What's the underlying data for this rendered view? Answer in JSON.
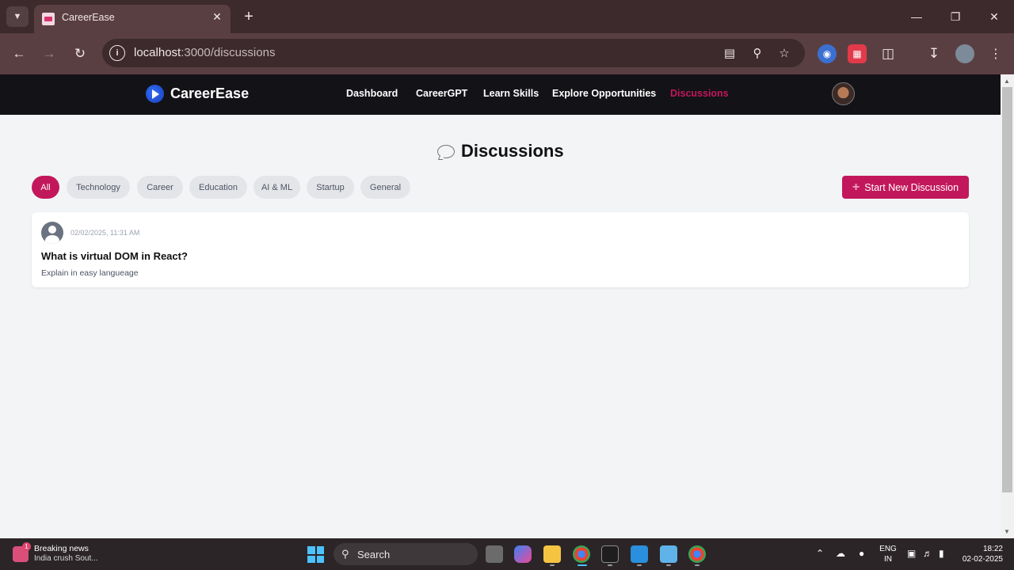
{
  "browser": {
    "tab_title": "CareerEase",
    "url_host": "localhost",
    "url_path": ":3000/discussions",
    "icons": {
      "tab_list": "chevron-down-icon",
      "close_tab": "close-icon",
      "new_tab": "plus-icon",
      "back": "arrow-left-icon",
      "forward": "arrow-right-icon",
      "reload": "reload-icon",
      "site_info": "info-icon",
      "install": "install-app-icon",
      "zoom": "zoom-icon",
      "bookmark": "star-icon",
      "extensions": "puzzle-icon",
      "downloads": "download-icon",
      "menu": "kebab-menu-icon"
    }
  },
  "site": {
    "brand": "CareerEase",
    "nav": [
      {
        "label": "Dashboard"
      },
      {
        "label": "CareerGPT"
      },
      {
        "label": "Learn Skills"
      },
      {
        "label": "Explore Opportunities"
      },
      {
        "label": "Discussions",
        "active": true
      }
    ]
  },
  "discussions": {
    "heading": "Discussions",
    "filters": [
      {
        "label": "All",
        "active": true
      },
      {
        "label": "Technology"
      },
      {
        "label": "Career"
      },
      {
        "label": "Education"
      },
      {
        "label": "AI & ML"
      },
      {
        "label": "Startup"
      },
      {
        "label": "General"
      }
    ],
    "new_button": "Start New Discussion",
    "posts": [
      {
        "date": "02/02/2025, 11:31 AM",
        "title": "What is virtual DOM in React?",
        "body": "Explain in easy langueage"
      }
    ]
  },
  "taskbar": {
    "news_badge": "1",
    "news_title": "Breaking news",
    "news_sub": "India crush Sout...",
    "search": "Search",
    "lang": "ENG",
    "region": "IN",
    "time": "18:22",
    "date": "02-02-2025"
  },
  "colors": {
    "accent": "#c2185b",
    "nav_bg": "#131217",
    "page_bg": "#f3f4f6",
    "browser_frame": "#5a3f42"
  }
}
